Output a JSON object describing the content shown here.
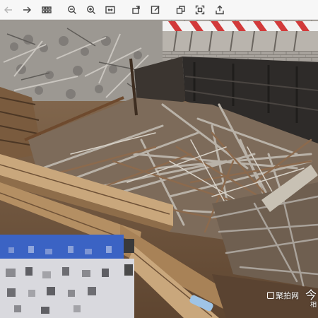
{
  "toolbar": {
    "buttons": [
      {
        "name": "back-button",
        "icon": "arrow-left-icon",
        "enabled": false
      },
      {
        "name": "forward-button",
        "icon": "arrow-right-icon",
        "enabled": true
      },
      {
        "name": "grid-view-button",
        "icon": "grid-icon",
        "enabled": true
      },
      {
        "name": "zoom-out-button",
        "icon": "zoom-out-icon",
        "enabled": true
      },
      {
        "name": "zoom-in-button",
        "icon": "zoom-in-icon",
        "enabled": true
      },
      {
        "name": "fit-view-button",
        "icon": "fit-icon",
        "enabled": true
      },
      {
        "name": "rotate-button",
        "icon": "rotate-icon",
        "enabled": true
      },
      {
        "name": "edit-button",
        "icon": "edit-icon",
        "enabled": true
      },
      {
        "name": "copy-button",
        "icon": "copy-icon",
        "enabled": true
      },
      {
        "name": "crop-button",
        "icon": "crop-icon",
        "enabled": true
      },
      {
        "name": "share-button",
        "icon": "share-icon",
        "enabled": true
      }
    ]
  },
  "photo": {
    "description_colors": {
      "sky": "#ffffff",
      "wall": "#8c8a87",
      "barrier_red": "#d23a3a",
      "scrap_metal": "#9a9590",
      "wood": "#c8a77e",
      "ground": "#7b5b3b"
    }
  },
  "watermark": {
    "logo_text": "聚拍网",
    "big_text": "今",
    "sub_text": "相"
  }
}
